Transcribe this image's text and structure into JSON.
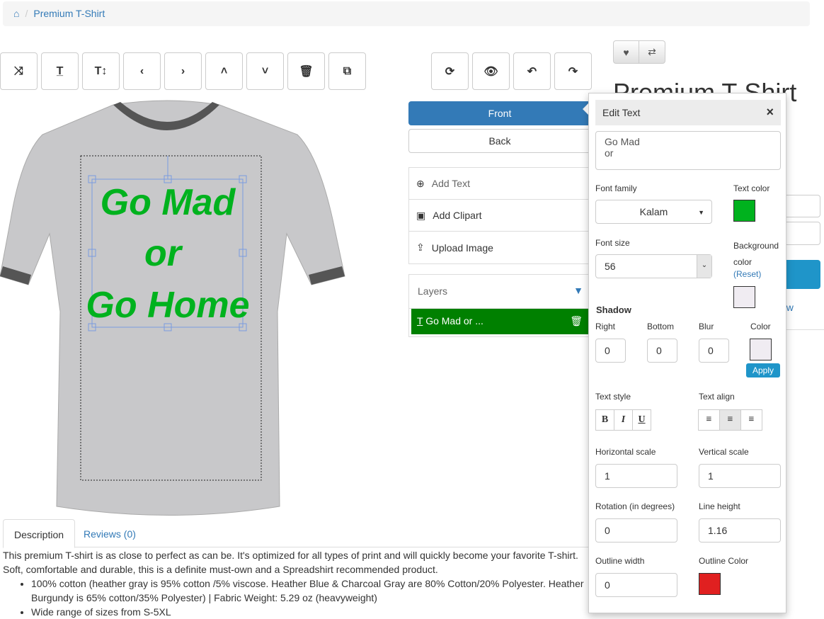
{
  "breadcrumb": {
    "home_icon": "home-icon",
    "current": "Premium T-Shirt"
  },
  "toolbar_left": [
    {
      "icon": "shuffle-icon",
      "glyph": "⤨"
    },
    {
      "icon": "text-icon",
      "glyph": "T̲"
    },
    {
      "icon": "text-height-icon",
      "glyph": "T↕"
    },
    {
      "icon": "chevron-left-icon",
      "glyph": "‹"
    },
    {
      "icon": "chevron-right-icon",
      "glyph": "›"
    },
    {
      "icon": "chevron-up-icon",
      "glyph": "˄"
    },
    {
      "icon": "chevron-down-icon",
      "glyph": "˅"
    },
    {
      "icon": "trash-icon",
      "glyph": "🗑"
    },
    {
      "icon": "copy-icon",
      "glyph": "⧉"
    }
  ],
  "toolbar_right": [
    {
      "icon": "refresh-icon",
      "glyph": "⟳"
    },
    {
      "icon": "eye-icon",
      "glyph": "👁"
    },
    {
      "icon": "undo-icon",
      "glyph": "↶"
    },
    {
      "icon": "redo-icon",
      "glyph": "↷"
    }
  ],
  "design": {
    "text_lines": [
      "Go Mad",
      "or",
      "Go Home"
    ],
    "text_color": "#00b21e",
    "shirt_color": "#c8c8ca"
  },
  "sides": {
    "front": "Front",
    "back": "Back"
  },
  "add_menu": [
    {
      "icon": "plus-circle-icon",
      "glyph": "⊕",
      "label": "Add Text"
    },
    {
      "icon": "image-icon",
      "glyph": "▣",
      "label": "Add Clipart"
    },
    {
      "icon": "upload-icon",
      "glyph": "⇪",
      "label": "Upload Image"
    }
  ],
  "layers": {
    "title": "Layers",
    "items": [
      {
        "label": "Go Mad or ...",
        "color": "#008000"
      }
    ]
  },
  "product": {
    "title": "Premium T-Shirt",
    "partial_link": "ew"
  },
  "tabs": {
    "description": "Description",
    "reviews": "Reviews (0)"
  },
  "description": {
    "paragraph": "This premium T-shirt is as close to perfect as can be. It's optimized for all types of print and will quickly become your favorite T-shirt. Soft, comfortable and durable, this is a definite must-own and a Spreadshirt recommended product.",
    "bullets": [
      "100% cotton (heather gray is 95% cotton /5% viscose. Heather Blue & Charcoal Gray are 80% Cotton/20% Polyester. Heather Burgundy is 65% cotton/35% Polyester) | Fabric Weight: 5.29 oz (heavyweight)",
      "Wide range of sizes from S-5XL"
    ]
  },
  "edit_text": {
    "title": "Edit Text",
    "close": "×",
    "text_value": "Go Mad\nor",
    "font_family_label": "Font family",
    "font_family": "Kalam",
    "text_color_label": "Text color",
    "text_color": "#00b21e",
    "font_size_label": "Font size",
    "font_size": "56",
    "bg_color_label": "Background color",
    "reset": "(Reset)",
    "bg_color": "#f0ecf2",
    "shadow_label": "Shadow",
    "shadow_right_label": "Right",
    "shadow_bottom_label": "Bottom",
    "shadow_blur_label": "Blur",
    "shadow_color_label": "Color",
    "shadow_right": "0",
    "shadow_bottom": "0",
    "shadow_blur": "0",
    "shadow_color": "#f0ecf2",
    "apply": "Apply",
    "text_style_label": "Text style",
    "bold": "B",
    "italic": "I",
    "underline": "U",
    "text_align_label": "Text align",
    "hscale_label": "Horizontal scale",
    "hscale": "1",
    "vscale_label": "Vertical scale",
    "vscale": "1",
    "rotation_label": "Rotation (in degrees)",
    "rotation": "0",
    "line_height_label": "Line height",
    "line_height": "1.16",
    "outline_width_label": "Outline width",
    "outline_width": "0",
    "outline_color_label": "Outline Color",
    "outline_color": "#e02020"
  }
}
